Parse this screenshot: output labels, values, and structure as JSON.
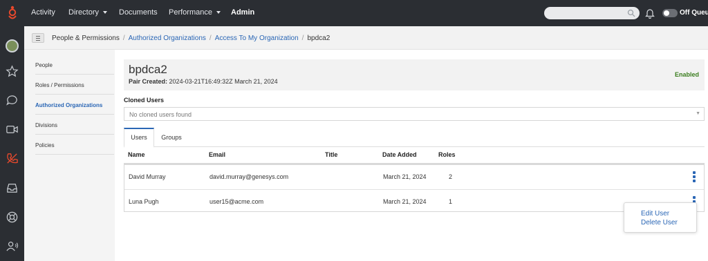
{
  "topbar": {
    "nav": [
      {
        "label": "Activity"
      },
      {
        "label": "Directory"
      },
      {
        "label": "Documents"
      },
      {
        "label": "Performance"
      },
      {
        "label": "Admin"
      }
    ],
    "queue_label": "Off Queue",
    "accent": "#e8492c"
  },
  "rail": {
    "icons": [
      "avatar",
      "star-icon",
      "chat-icon",
      "video-icon",
      "phone-icon",
      "inbox-icon",
      "help-icon",
      "contacts-icon"
    ]
  },
  "breadcrumb": {
    "items": [
      "People & Permissions",
      "Authorized Organizations",
      "Access To My Organization",
      "bpdca2"
    ]
  },
  "sidemenu": {
    "items": [
      "People",
      "Roles / Permissions",
      "Authorized Organizations",
      "Divisions",
      "Policies"
    ]
  },
  "org": {
    "name": "bpdca2",
    "pair_label": "Pair Created:",
    "pair_value": "2024-03-21T16:49:32Z March 21, 2024",
    "status": "Enabled",
    "status_color": "#3a7d1e"
  },
  "cloned": {
    "label": "Cloned Users",
    "placeholder": "No cloned users found"
  },
  "tabs": [
    "Users",
    "Groups"
  ],
  "table": {
    "columns": [
      "Name",
      "Email",
      "Title",
      "Date Added",
      "Roles"
    ],
    "rows": [
      {
        "name": "David Murray",
        "email": "david.murray@genesys.com",
        "title": "",
        "date": "March 21, 2024",
        "roles": "2"
      },
      {
        "name": "Luna Pugh",
        "email": "user15@acme.com",
        "title": "",
        "date": "March 21, 2024",
        "roles": "1"
      }
    ]
  },
  "popup": {
    "items": [
      "Edit User",
      "Delete User"
    ]
  },
  "link_color": "#2a66b5"
}
